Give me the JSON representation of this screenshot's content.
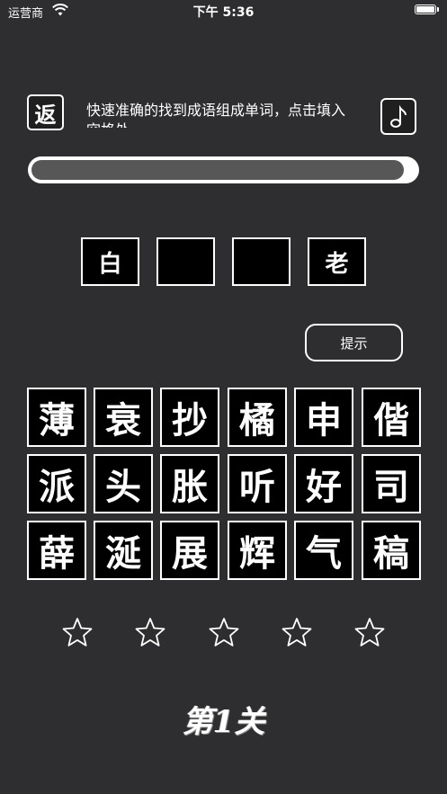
{
  "status_bar": {
    "carrier": "运营商",
    "time": "下午 5:36"
  },
  "header": {
    "back_label": "返",
    "instruction": "快速准确的找到成语组成单词，点击填入空格处",
    "music_icon": "music-note-icon"
  },
  "progress": {
    "fill_percent": 97
  },
  "answer": {
    "slots": [
      "白",
      "",
      "",
      "老"
    ]
  },
  "hint": {
    "label": "提示"
  },
  "characters": [
    [
      "薄",
      "衰",
      "抄",
      "橘",
      "申",
      "偕"
    ],
    [
      "派",
      "头",
      "胀",
      "听",
      "好",
      "司"
    ],
    [
      "薛",
      "涎",
      "展",
      "辉",
      "气",
      "稿"
    ]
  ],
  "rating": {
    "max_stars": 5,
    "filled_stars": 0
  },
  "level": {
    "label": "第1关"
  }
}
